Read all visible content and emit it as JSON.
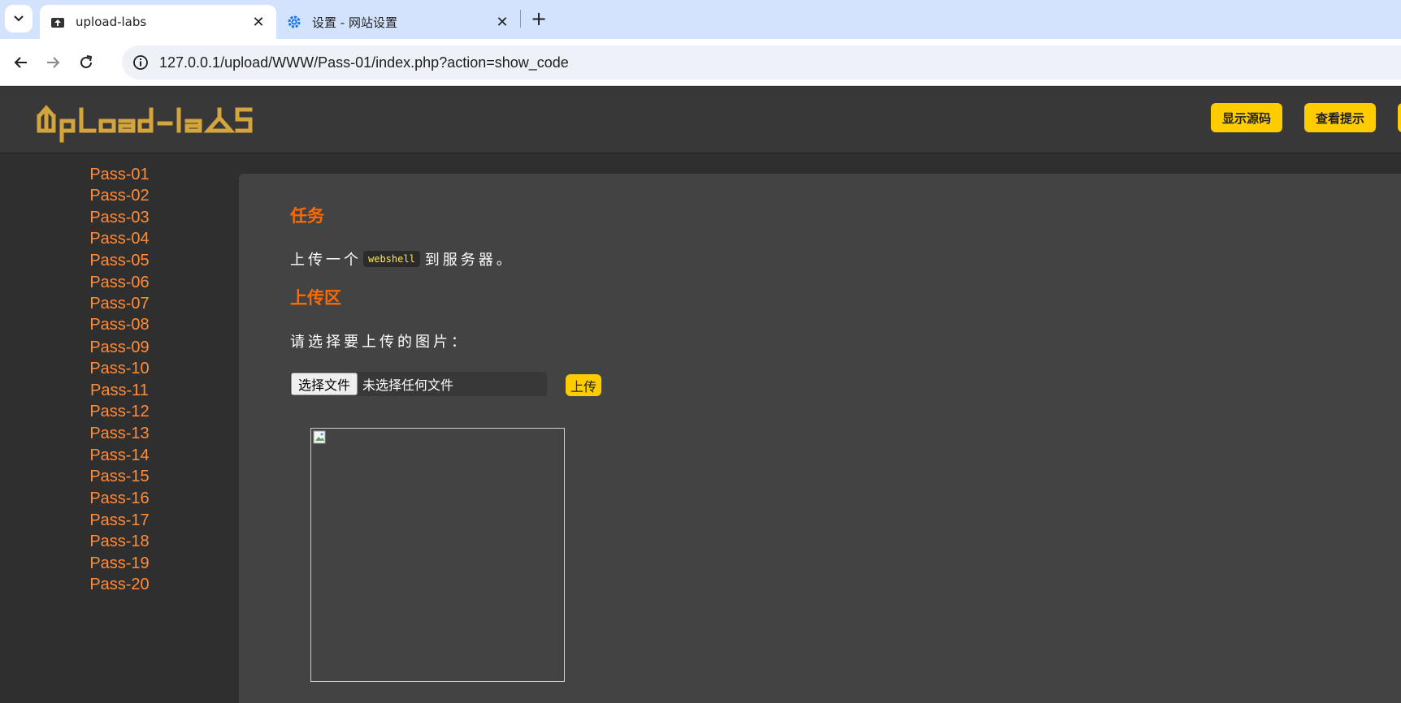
{
  "browser": {
    "tabs": [
      {
        "title": "upload-labs",
        "favicon": "cloud-upload-icon",
        "active": true
      },
      {
        "title": "设置 - 网站设置",
        "favicon": "gear-icon",
        "active": false
      }
    ],
    "url": "127.0.0.1/upload/WWW/Pass-01/index.php?action=show_code"
  },
  "header": {
    "logo_text": "UpLoad-LabS",
    "buttons": [
      "显示源码",
      "查看提示"
    ]
  },
  "sidebar": {
    "items": [
      "Pass-01",
      "Pass-02",
      "Pass-03",
      "Pass-04",
      "Pass-05",
      "Pass-06",
      "Pass-07",
      "Pass-08",
      "Pass-09",
      "Pass-10",
      "Pass-11",
      "Pass-12",
      "Pass-13",
      "Pass-14",
      "Pass-15",
      "Pass-16",
      "Pass-17",
      "Pass-18",
      "Pass-19",
      "Pass-20"
    ]
  },
  "main": {
    "task_heading": "任务",
    "task_prefix": "上传一个",
    "task_code": "webshell",
    "task_suffix": "到服务器。",
    "upload_heading": "上传区",
    "prompt": "请选择要上传的图片：",
    "file_button": "选择文件",
    "file_status": "未选择任何文件",
    "upload_button": "上传"
  },
  "colors": {
    "accent_yellow": "#ffcc00",
    "heading_orange": "#ff6a00",
    "link_orange": "#ff8c3a",
    "logo_gold": "#d4a53c"
  }
}
